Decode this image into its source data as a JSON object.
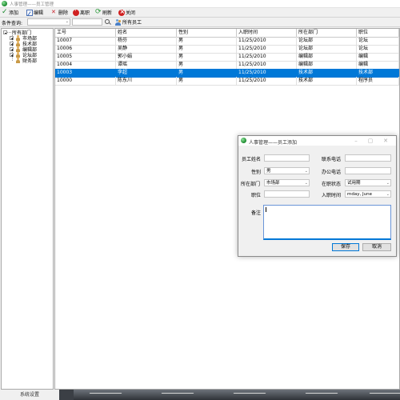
{
  "window": {
    "title": "人事管理——员工管理"
  },
  "toolbar": {
    "add": "添加",
    "edit": "编辑",
    "delete": "删除",
    "leave": "离职",
    "refresh": "刷新",
    "close": "关闭"
  },
  "filter": {
    "label": "条件查询:",
    "all_employees": "所有员工"
  },
  "tree": {
    "root": "所有部门",
    "items": [
      "市场部",
      "技术部",
      "编辑部",
      "论坛部",
      "财务部"
    ]
  },
  "grid": {
    "columns": [
      "工号",
      "姓名",
      "性别",
      "入职时间",
      "所在部门",
      "职位"
    ],
    "rows": [
      [
        "10007",
        "杨芬",
        "男",
        "11/25/2010",
        "论坛部",
        "论坛"
      ],
      [
        "10006",
        "吴静",
        "男",
        "11/25/2010",
        "论坛部",
        "论坛"
      ],
      [
        "10005",
        "郭小娟",
        "男",
        "11/25/2010",
        "编辑部",
        "编辑"
      ],
      [
        "10004",
        "谭瑶",
        "男",
        "11/25/2010",
        "编辑部",
        "编辑"
      ],
      [
        "10003",
        "李超",
        "男",
        "11/25/2010",
        "技术部",
        "技术部"
      ],
      [
        "10000",
        "陈东川",
        "男",
        "11/25/2010",
        "技术部",
        "程序员"
      ]
    ],
    "selected_row": 4
  },
  "status": {
    "tab": "系统设置"
  },
  "dialog": {
    "title": "人事管理——员工添加",
    "labels": {
      "name": "员工姓名",
      "phone": "联系电话",
      "gender": "性别",
      "office_phone": "办公电话",
      "department": "所在部门",
      "status": "在职状态",
      "position": "职位",
      "hire_date": "入职时间",
      "note": "备注"
    },
    "values": {
      "gender": "男",
      "department": "市场部",
      "status": "试用期",
      "hire_date": "mday,  June"
    },
    "save": "保存",
    "cancel": "取消"
  },
  "colors": {
    "selection": "#0078d7",
    "accent_green": "#17862b",
    "close_red": "#d02020"
  }
}
